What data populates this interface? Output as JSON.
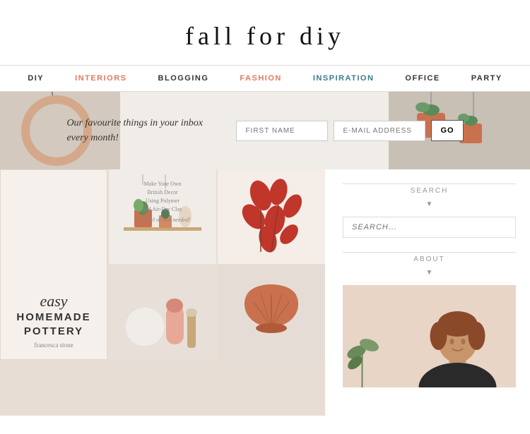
{
  "site": {
    "title": "fall for diy"
  },
  "nav": {
    "items": [
      {
        "label": "DIY",
        "class": "diy"
      },
      {
        "label": "INTERIORS",
        "class": "interiors"
      },
      {
        "label": "BLOGGING",
        "class": "blogging"
      },
      {
        "label": "FASHION",
        "class": "fashion"
      },
      {
        "label": "INSPIRATION",
        "class": "inspiration"
      },
      {
        "label": "OFFICE",
        "class": "office"
      },
      {
        "label": "PARTY",
        "class": "party"
      }
    ]
  },
  "banner": {
    "text": "Our favourite things in your inbox every month!",
    "first_name_placeholder": "FIRST NAME",
    "email_placeholder": "E-MAIL ADDRESS",
    "button_label": "GO"
  },
  "sidebar": {
    "search_label": "SEARCH",
    "search_placeholder": "SEARCH...",
    "about_label": "ABOUT"
  },
  "article": {
    "book_easy": "easy",
    "book_main": "HOMEMADE\nPOTTERY",
    "book_author": "francesca stone"
  }
}
